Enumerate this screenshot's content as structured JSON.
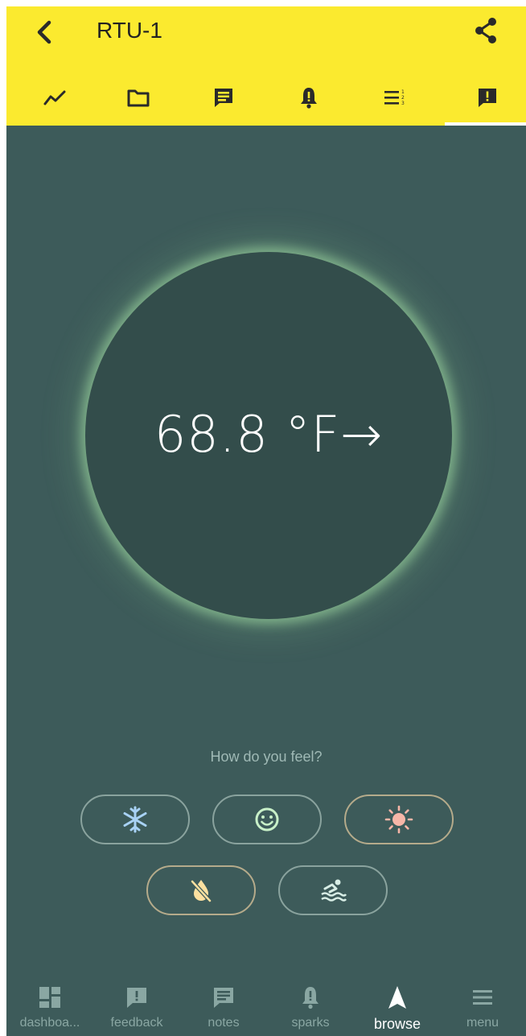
{
  "header": {
    "title": "RTU-1",
    "back_icon": "chevron-left-icon",
    "share_icon": "share-icon"
  },
  "tabs": [
    {
      "icon": "trend-icon",
      "name": "trends"
    },
    {
      "icon": "folder-icon",
      "name": "files"
    },
    {
      "icon": "notes-icon",
      "name": "notes"
    },
    {
      "icon": "bell-icon",
      "name": "alarms"
    },
    {
      "icon": "list-icon",
      "name": "list"
    },
    {
      "icon": "feedback-icon",
      "name": "feedback",
      "active": true
    }
  ],
  "thermostat": {
    "temperature": "68.8 °F→",
    "glow_color": "#a8e0a8"
  },
  "feedback": {
    "question": "How do you feel?",
    "options": [
      {
        "icon": "snowflake-icon",
        "color": "#a8d2f5"
      },
      {
        "icon": "smiley-icon",
        "color": "#c8f0c8"
      },
      {
        "icon": "sun-icon",
        "color": "#f7b6a8"
      },
      {
        "icon": "no-drip-icon",
        "color": "#fce0a0"
      },
      {
        "icon": "swimmer-icon",
        "color": "#d8eee6"
      }
    ]
  },
  "bottom_nav": [
    {
      "label": "dashboa...",
      "icon": "dashboard-icon"
    },
    {
      "label": "feedback",
      "icon": "feedback-icon"
    },
    {
      "label": "notes",
      "icon": "notes-icon"
    },
    {
      "label": "sparks",
      "icon": "bell-icon"
    },
    {
      "label": "browse",
      "icon": "navigation-arrow-icon",
      "active": true
    },
    {
      "label": "menu",
      "icon": "menu-icon"
    }
  ],
  "colors": {
    "header_bg": "#fbea2f",
    "screen_bg": "#3d5b5a",
    "circle_bg": "#334d4b"
  }
}
